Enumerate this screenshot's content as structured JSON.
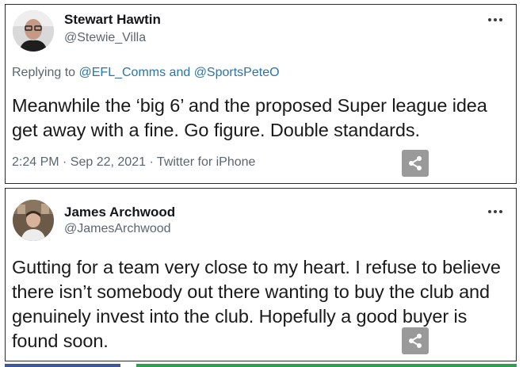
{
  "tweets": [
    {
      "name": "Stewart Hawtin",
      "handle": "@Stewie_Villa",
      "reply_prefix": "Replying to ",
      "reply_mention_1": "@EFL_Comms",
      "reply_and": " and ",
      "reply_mention_2": "@SportsPeteO",
      "text": "Meanwhile the ‘big 6’ and the proposed Super league idea get away with a fine. Go figure. Double standards.",
      "timestamp": "2:24 PM · Sep 22, 2021 · Twitter for iPhone",
      "more_icon": "more-horizontal-icon",
      "share_icon": "share-icon"
    },
    {
      "name": "James Archwood",
      "handle": "@JamesArchwood",
      "text": "Gutting for a team very close to my heart. I refuse to believe there isn’t somebody out there wanting to buy the club and genuinely invest into the club. Hopefully a good buyer is found soon.",
      "more_icon": "more-horizontal-icon",
      "share_icon": "share-icon"
    }
  ],
  "colors": {
    "link": "#2a74a8",
    "secondary_text": "#5b6670",
    "share_button": "#9a9a9a",
    "bottom_bar_left": "#3b5998",
    "bottom_bar_right": "#2e9e4f"
  }
}
